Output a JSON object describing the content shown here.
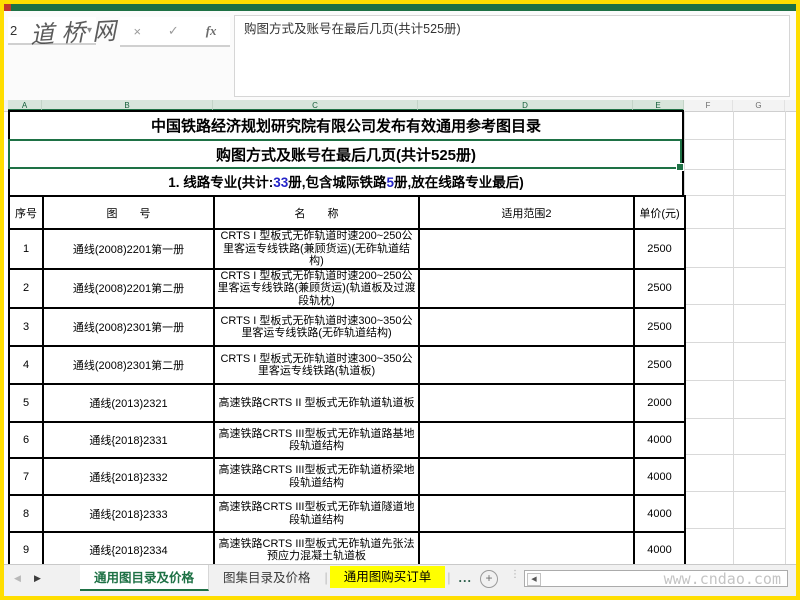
{
  "window": {
    "name_box_value": "2",
    "name_box_dropdown": "▾",
    "formula_bar_text": "购图方式及账号在最后几页(共计525册)",
    "cancel_icon": "×",
    "confirm_icon": "✓",
    "fx_icon": "fx",
    "watermark_top": "道桥网",
    "watermark_bottom": "www.cndao.com"
  },
  "colors": {
    "frame_border": "#FFDE00",
    "excel_green": "#1E7145",
    "selection_green": "#217346",
    "tab_highlight": "#FFFF00",
    "blue_number": "#2424C8",
    "red_dot": "#C0392B"
  },
  "sheet": {
    "columns": [
      "A",
      "B",
      "C",
      "D",
      "E",
      "F",
      "G"
    ],
    "titles": {
      "t1": "中国铁路经济规划研究院有限公司发布有效通用参考图目录",
      "t2": "购图方式及账号在最后几页(共计525册)",
      "t3_pre": "1. 线路专业(共计:",
      "t3_num1": "33",
      "t3_mid": "册,包含城际铁路",
      "t3_num2": "5",
      "t3_suf": "册,放在线路专业最后)"
    }
  },
  "table": {
    "headers": [
      "序号",
      "图　　号",
      "名　　称",
      "适用范围2",
      "单价(元)"
    ],
    "rows": [
      {
        "no": "1",
        "code": "通线(2008)2201第一册",
        "name": "CRTS I 型板式无砟轨道时速200~250公里客运专线铁路(兼顾货运)(无砟轨道结构)",
        "scope": "",
        "price": "2500"
      },
      {
        "no": "2",
        "code": "通线(2008)2201第二册",
        "name": "CRTS I 型板式无砟轨道时速200~250公里客运专线铁路(兼顾货运)(轨道板及过渡段轨枕)",
        "scope": "",
        "price": "2500"
      },
      {
        "no": "3",
        "code": "通线(2008)2301第一册",
        "name": "CRTS I 型板式无砟轨道时速300~350公里客运专线铁路(无砟轨道结构)",
        "scope": "",
        "price": "2500"
      },
      {
        "no": "4",
        "code": "通线(2008)2301第二册",
        "name": "CRTS I 型板式无砟轨道时速300~350公里客运专线铁路(轨道板)",
        "scope": "",
        "price": "2500"
      },
      {
        "no": "5",
        "code": "通线(2013)2321",
        "name": "高速铁路CRTS II 型板式无砟轨道轨道板",
        "scope": "",
        "price": "2000"
      },
      {
        "no": "6",
        "code": "通线{2018}2331",
        "name": "高速铁路CRTS  III型板式无砟轨道路基地段轨道结构",
        "scope": "",
        "price": "4000"
      },
      {
        "no": "7",
        "code": "通线{2018}2332",
        "name": "高速铁路CRTS  III型板式无砟轨道桥梁地段轨道结构",
        "scope": "",
        "price": "4000"
      },
      {
        "no": "8",
        "code": "通线{2018}2333",
        "name": "高速铁路CRTS  III型板式无砟轨道隧道地段轨道结构",
        "scope": "",
        "price": "4000"
      },
      {
        "no": "9",
        "code": "通线{2018}2334",
        "name": "高速铁路CRTS  III型板式无砟轨道先张法预应力混凝土轨道板",
        "scope": "",
        "price": "4000"
      }
    ]
  },
  "tabbar": {
    "nav_left": "◀",
    "nav_right": "▶",
    "tabs": [
      "通用图目录及价格",
      "图集目录及价格",
      "通用图购买订单"
    ],
    "separator": "|",
    "more": "...",
    "add": "+",
    "scroll_left_arrow": "◀"
  }
}
